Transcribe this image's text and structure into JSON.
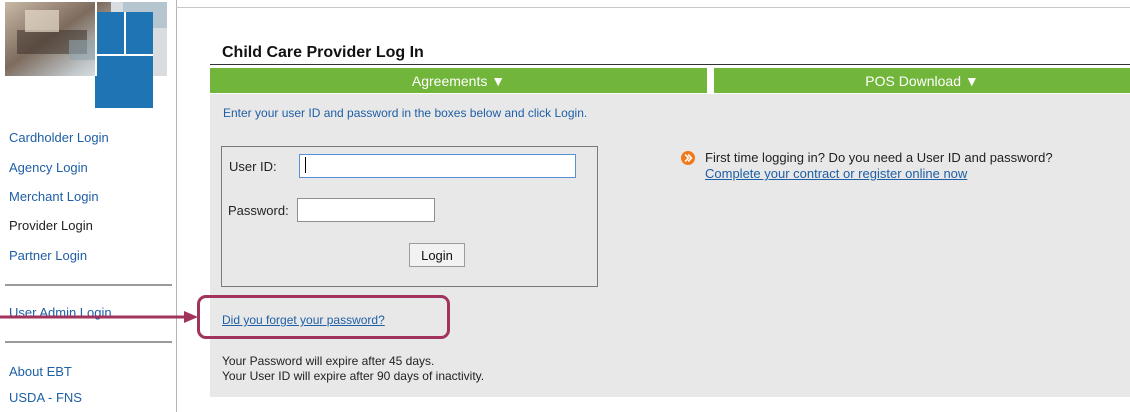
{
  "sidebar": {
    "items": [
      {
        "label": "Cardholder Login"
      },
      {
        "label": "Agency Login"
      },
      {
        "label": "Merchant Login"
      },
      {
        "label": "Provider Login"
      },
      {
        "label": "Partner Login"
      },
      {
        "label": "User Admin Login"
      },
      {
        "label": "About EBT"
      },
      {
        "label": "USDA - FNS"
      }
    ]
  },
  "header": {
    "title": "Child Care Provider Log In"
  },
  "menu": {
    "agreements": "Agreements ▼",
    "pos_download": "POS Download ▼"
  },
  "main": {
    "intro": "Enter your user ID and password in the boxes below and click Login.",
    "user_id_label": "User ID:",
    "user_id_value": "",
    "password_label": "Password:",
    "password_value": "",
    "login_label": "Login",
    "first_time_question": "First time logging in? Do you need a User ID and password?",
    "register_link": "Complete your contract or register online now",
    "forgot_link": "Did you forget your password?",
    "expire_password": "Your Password will expire after 45 days.",
    "expire_userid": "Your User ID will expire after 90 days of inactivity."
  },
  "colors": {
    "link": "#1f5fa5",
    "menu_green": "#71b53a",
    "content_bg": "#e8e8e8",
    "highlight": "#a0345c",
    "info_orange": "#f07a1a"
  },
  "icons": {
    "first_time": "orange-arrow-circle-icon",
    "callout": "callout-arrow-icon"
  }
}
